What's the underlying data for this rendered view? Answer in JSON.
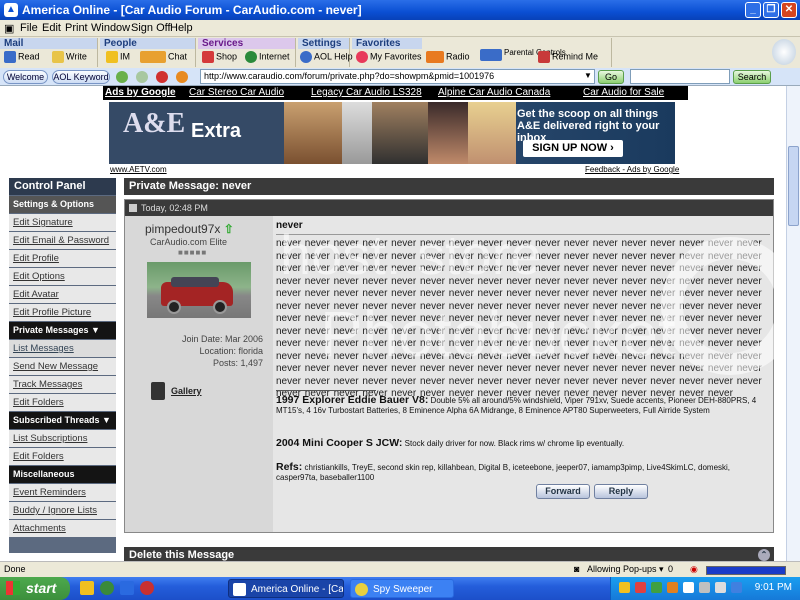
{
  "window": {
    "title": "America Online - [Car Audio Forum - CarAudio.com - never]"
  },
  "menu": [
    "File",
    "Edit",
    "Print",
    "Window",
    "Sign Off",
    "Help"
  ],
  "toolbar": {
    "groups": [
      {
        "label": "Mail",
        "color": "#1d58b8",
        "items": [
          "Read",
          "Write"
        ]
      },
      {
        "label": "People",
        "color": "#1d58b8",
        "items": [
          "IM",
          "Chat"
        ]
      },
      {
        "label": "Services",
        "color": "#8a2aa8",
        "items": [
          "Shop",
          "Internet",
          "AOL Help"
        ]
      },
      {
        "label": "Settings",
        "color": "#1d58b8",
        "items": [
          "My Favorites"
        ]
      },
      {
        "label": "Favorites",
        "color": "#1d58b8",
        "items": [
          "Radio",
          "Parental Controls",
          "Remind Me"
        ]
      }
    ]
  },
  "nav": {
    "welcome": "Welcome",
    "keyword": "AOL Keyword",
    "url": "http://www.caraudio.com/forum/private.php?do=showpm&pmid=1001976",
    "go": "Go",
    "search": "Search"
  },
  "ads": {
    "label": "Ads by Google",
    "links": [
      "Car Stereo Car Audio",
      "Legacy Car Audio LS328",
      "Alpine Car Audio Canada",
      "Car Audio for Sale"
    ]
  },
  "banner": {
    "brand1": "A&E",
    "brand2": "Extra",
    "text": "Get the scoop on all things A&E delivered right to your inbox",
    "cta": "SIGN UP NOW ›",
    "site": "www.AETV.com",
    "feedback": "Feedback - Ads by Google"
  },
  "cpanel": {
    "title": "Control Panel",
    "sections": [
      {
        "title": "Settings & Options",
        "items": [
          "Edit Signature",
          "Edit Email & Password",
          "Edit Profile",
          "Edit Options",
          "Edit Avatar",
          "Edit Profile Picture"
        ]
      },
      {
        "title": "Private Messages ▼",
        "items": [
          "List Messages",
          "Send New Message",
          "Track Messages",
          "Edit Folders"
        ]
      },
      {
        "title": "Subscribed Threads ▼",
        "items": [
          "List Subscriptions",
          "Edit Folders"
        ]
      },
      {
        "title": "Miscellaneous",
        "items": [
          "Event Reminders",
          "Buddy / Ignore Lists",
          "Attachments"
        ]
      }
    ]
  },
  "pm": {
    "header": "Private Message: never",
    "date": "Today, 02:48 PM",
    "user": {
      "name": "pimpedout97x",
      "title": "CarAudio.com Elite",
      "rep": "■■■■■",
      "join": "Join Date: Mar 2006",
      "location": "Location: florida",
      "posts": "Posts: 1,497",
      "gallery": "Gallery"
    },
    "title": "never",
    "body": "never never never never never never never never never never never never never never never never never never never never never never never never never never never never never never never never never never never never never never never never never never never never never never never never never never never never never never never never never never never never never never never never never never never never never never never never never never never never never never never never never never never never never never never never never never never never never never never never never never never never never never never never never never never never never never never never never never never never never never never never never never never never never never never never never never never never never never never never never never never never never never never never never never never never never never never never never never never never never never never never never never never never never never never never never never never never never never never never never never never never never never never never never never never never never never never never never never never never never never never never never never never never never never never never never never never never never never never never never never never never",
    "sig1_title": "1997 Explorer Eddie Bauer V8:",
    "sig1_text": " Double 5% all around/5% windshield, Viper 791xv, Suede accents, Pioneer DEH-880PRS, 4 MT15's, 4 16v Turbostart Batteries, 8 Eminence Alpha 6A Midrange, 8 Eminence APT80 Superweeters, Full Airride System",
    "sig2_title": "2004 Mini Cooper S JCW:",
    "sig2_text": " Stock daily driver for now. Black rims w/ chrome lip eventually.",
    "sig3_title": "Refs:",
    "sig3_text": " christiankills, TreyE, second skin rep, killahbean, Digital B, iceteebone, jeeper07, iamamp3pimp, Live4SkimLC, domeski, casper97ta, baseballer1100",
    "forward": "Forward",
    "reply": "Reply",
    "delete": "Delete this Message"
  },
  "watermark": {
    "line1": "host. store",
    "line2": "Photobucket"
  },
  "status": {
    "left": "Done",
    "popups": "Allowing Pop-ups ▾",
    "count": "0",
    "progress": 1.0
  },
  "taskbar": {
    "start": "start",
    "tasks": [
      "America Online - [Ca...",
      "Spy Sweeper"
    ],
    "time": "9:01 PM"
  }
}
